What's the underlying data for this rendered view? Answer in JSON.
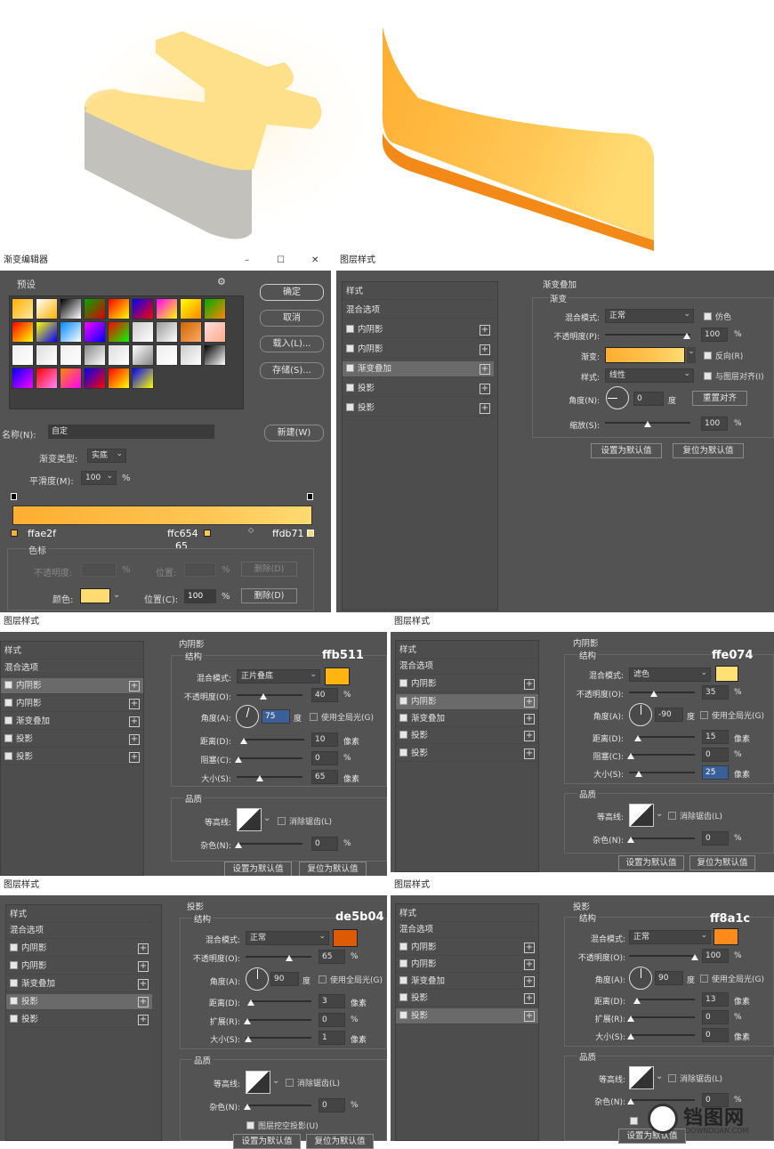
{
  "gradient_editor": {
    "title": "渐变编辑器",
    "presets_label": "预设",
    "ok": "确定",
    "cancel": "取消",
    "load": "载入(L)...",
    "save": "存储(S)...",
    "name_label": "名称(N):",
    "name_value": "自定",
    "new_button": "新建(W)",
    "type_label": "渐变类型:",
    "type_value": "实底",
    "smooth_label": "平滑度(M):",
    "smooth_value": "100",
    "smooth_unit": "%",
    "stop1_hex": "ffae2f",
    "stop2_hex": "ffc654",
    "stop2_pos": "65",
    "stop3_hex": "ffdb71",
    "colorstop_label": "色标",
    "opacity_label": "不透明度:",
    "opacity_unit": "%",
    "position_label": "位置:",
    "position_unit": "%",
    "delete_label": "删除(D)",
    "color_label": "颜色:",
    "position_c_label": "位置(C):",
    "position_c_value": "100",
    "position_c_unit": "%",
    "delete_active": "删除(D)",
    "gradient_colors": [
      "#ffae2f",
      "#ffc654",
      "#ffdb71"
    ]
  },
  "panel_top_right": {
    "title": "图层样式",
    "side": {
      "styles": "样式",
      "blending": "混合选项",
      "items": [
        "内阴影",
        "内阴影",
        "渐变叠加",
        "投影",
        "投影"
      ]
    },
    "section": "渐变叠加",
    "subsection": "渐变",
    "blend_label": "混合模式:",
    "blend_value": "正常",
    "dither": "仿色",
    "opacity_label": "不透明度(P):",
    "opacity_value": "100",
    "gradient_label": "渐变:",
    "reverse": "反向(R)",
    "style_label": "样式:",
    "style_value": "线性",
    "align": "与图层对齐(I)",
    "angle_label": "角度(N):",
    "angle_value": "0",
    "angle_unit": "度",
    "reset_align": "重置对齐",
    "scale_label": "缩放(S):",
    "scale_value": "100",
    "set_default": "设置为默认值",
    "reset_default": "复位为默认值",
    "pct": "%",
    "slider_opacity": 1.0,
    "slider_scale": 0.5
  },
  "panel_mid_left": {
    "title": "图层样式",
    "side": {
      "styles": "样式",
      "blending": "混合选项",
      "items": [
        "内阴影",
        "内阴影",
        "渐变叠加",
        "投影",
        "投影"
      ]
    },
    "section": "内阴影",
    "structure": "结构",
    "hex": "ffb511",
    "color": "#ffb511",
    "blend_label": "混合模式:",
    "blend_value": "正片叠底",
    "opacity_label": "不透明度(O):",
    "opacity_value": "40",
    "angle_label": "角度(A):",
    "angle_value": "75",
    "angle_unit": "度",
    "global": "使用全局光(G)",
    "distance_label": "距离(D):",
    "distance_value": "10",
    "choke_label": "阻塞(C):",
    "choke_value": "0",
    "size_label": "大小(S):",
    "size_value": "65",
    "px": "像素",
    "pct": "%",
    "quality": "品质",
    "contour_label": "等高线:",
    "antialias": "消除锯齿(L)",
    "noise_label": "杂色(N):",
    "noise_value": "0",
    "set_default": "设置为默认值",
    "reset_default": "复位为默认值"
  },
  "panel_mid_right": {
    "title": "图层样式",
    "side": {
      "styles": "样式",
      "blending": "混合选项",
      "items": [
        "内阴影",
        "内阴影",
        "渐变叠加",
        "投影",
        "投影"
      ]
    },
    "section": "内阴影",
    "structure": "结构",
    "hex": "ffe074",
    "color": "#ffe074",
    "blend_label": "混合模式:",
    "blend_value": "滤色",
    "opacity_label": "不透明度(O):",
    "opacity_value": "35",
    "angle_label": "角度(A):",
    "angle_value": "-90",
    "angle_unit": "度",
    "global": "使用全局光(G)",
    "distance_label": "距离(D):",
    "distance_value": "15",
    "choke_label": "阻塞(C):",
    "choke_value": "0",
    "size_label": "大小(S):",
    "size_value": "25",
    "px": "像素",
    "pct": "%",
    "quality": "品质",
    "contour_label": "等高线:",
    "antialias": "消除锯齿(L)",
    "noise_label": "杂色(N):",
    "noise_value": "0",
    "set_default": "设置为默认值",
    "reset_default": "复位为默认值"
  },
  "panel_bot_left": {
    "title": "图层样式",
    "side": {
      "styles": "样式",
      "blending": "混合选项",
      "items": [
        "内阴影",
        "内阴影",
        "渐变叠加",
        "投影",
        "投影"
      ]
    },
    "section": "投影",
    "structure": "结构",
    "hex": "de5b04",
    "color": "#de5b04",
    "blend_label": "混合模式:",
    "blend_value": "正常",
    "opacity_label": "不透明度(O):",
    "opacity_value": "65",
    "angle_label": "角度(A):",
    "angle_value": "90",
    "angle_unit": "度",
    "global": "使用全局光(G)",
    "distance_label": "距离(D):",
    "distance_value": "3",
    "spread_label": "扩展(R):",
    "spread_value": "0",
    "size_label": "大小(S):",
    "size_value": "1",
    "px": "像素",
    "pct": "%",
    "quality": "品质",
    "contour_label": "等高线:",
    "antialias": "消除锯齿(L)",
    "noise_label": "杂色(N):",
    "noise_value": "0",
    "knockout": "图层挖空投影(U)",
    "set_default": "设置为默认值",
    "reset_default": "复位为默认值"
  },
  "panel_bot_right": {
    "title": "图层样式",
    "side": {
      "styles": "样式",
      "blending": "混合选项",
      "items": [
        "内阴影",
        "内阴影",
        "渐变叠加",
        "投影",
        "投影"
      ]
    },
    "section": "投影",
    "structure": "结构",
    "hex": "ff8a1c",
    "color": "#ff8a1c",
    "blend_label": "混合模式:",
    "blend_value": "正常",
    "opacity_label": "不透明度(O):",
    "opacity_value": "100",
    "angle_label": "角度(A):",
    "angle_value": "90",
    "angle_unit": "度",
    "global": "使用全局光(G)",
    "distance_label": "距离(D):",
    "distance_value": "13",
    "spread_label": "扩展(R):",
    "spread_value": "0",
    "size_label": "大小(S):",
    "size_value": "0",
    "px": "像素",
    "pct": "%",
    "quality": "品质",
    "contour_label": "等高线:",
    "antialias": "消除锯齿(L)",
    "noise_label": "杂色(N):",
    "noise_value": "0",
    "set_default": "设置为默认值"
  },
  "watermark": {
    "text": "铛图网",
    "sub": "DOWNDOAN.COM"
  }
}
